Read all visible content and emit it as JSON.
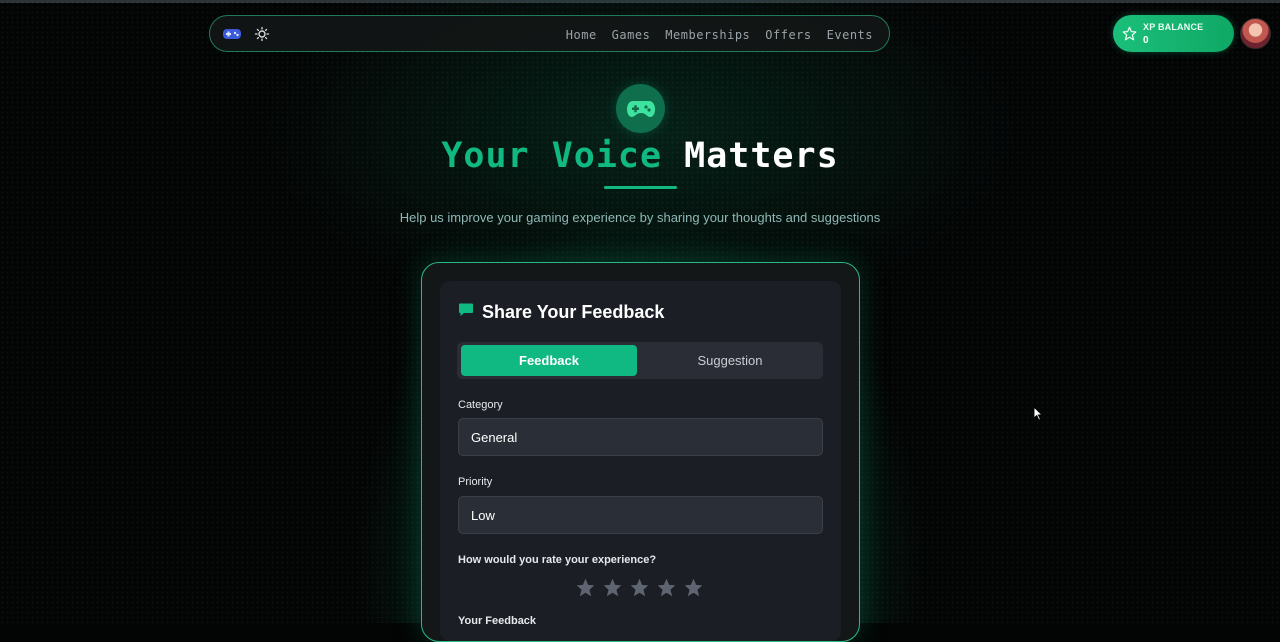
{
  "nav": {
    "links": [
      "Home",
      "Games",
      "Memberships",
      "Offers",
      "Events"
    ],
    "logo_icon": "gamepad-icon",
    "theme_icon": "sun-icon"
  },
  "xp": {
    "label": "XP BALANCE",
    "value": "0",
    "icon": "star-icon"
  },
  "hero": {
    "icon": "gamepad-icon",
    "title_green": "Your Voice",
    "title_white": "Matters",
    "subtitle": "Help us improve your gaming experience by sharing your thoughts and suggestions"
  },
  "form": {
    "title": "Share Your Feedback",
    "title_icon": "chat-bubble-icon",
    "tabs": {
      "active": "Feedback",
      "inactive": "Suggestion"
    },
    "category": {
      "label": "Category",
      "value": "General"
    },
    "priority": {
      "label": "Priority",
      "value": "Low"
    },
    "rating": {
      "label": "How would you rate your experience?",
      "max": 5,
      "value": 0
    },
    "feedback_label": "Your Feedback"
  },
  "colors": {
    "accent": "#10b981",
    "card": "#1b1e24",
    "background": "#030404"
  }
}
